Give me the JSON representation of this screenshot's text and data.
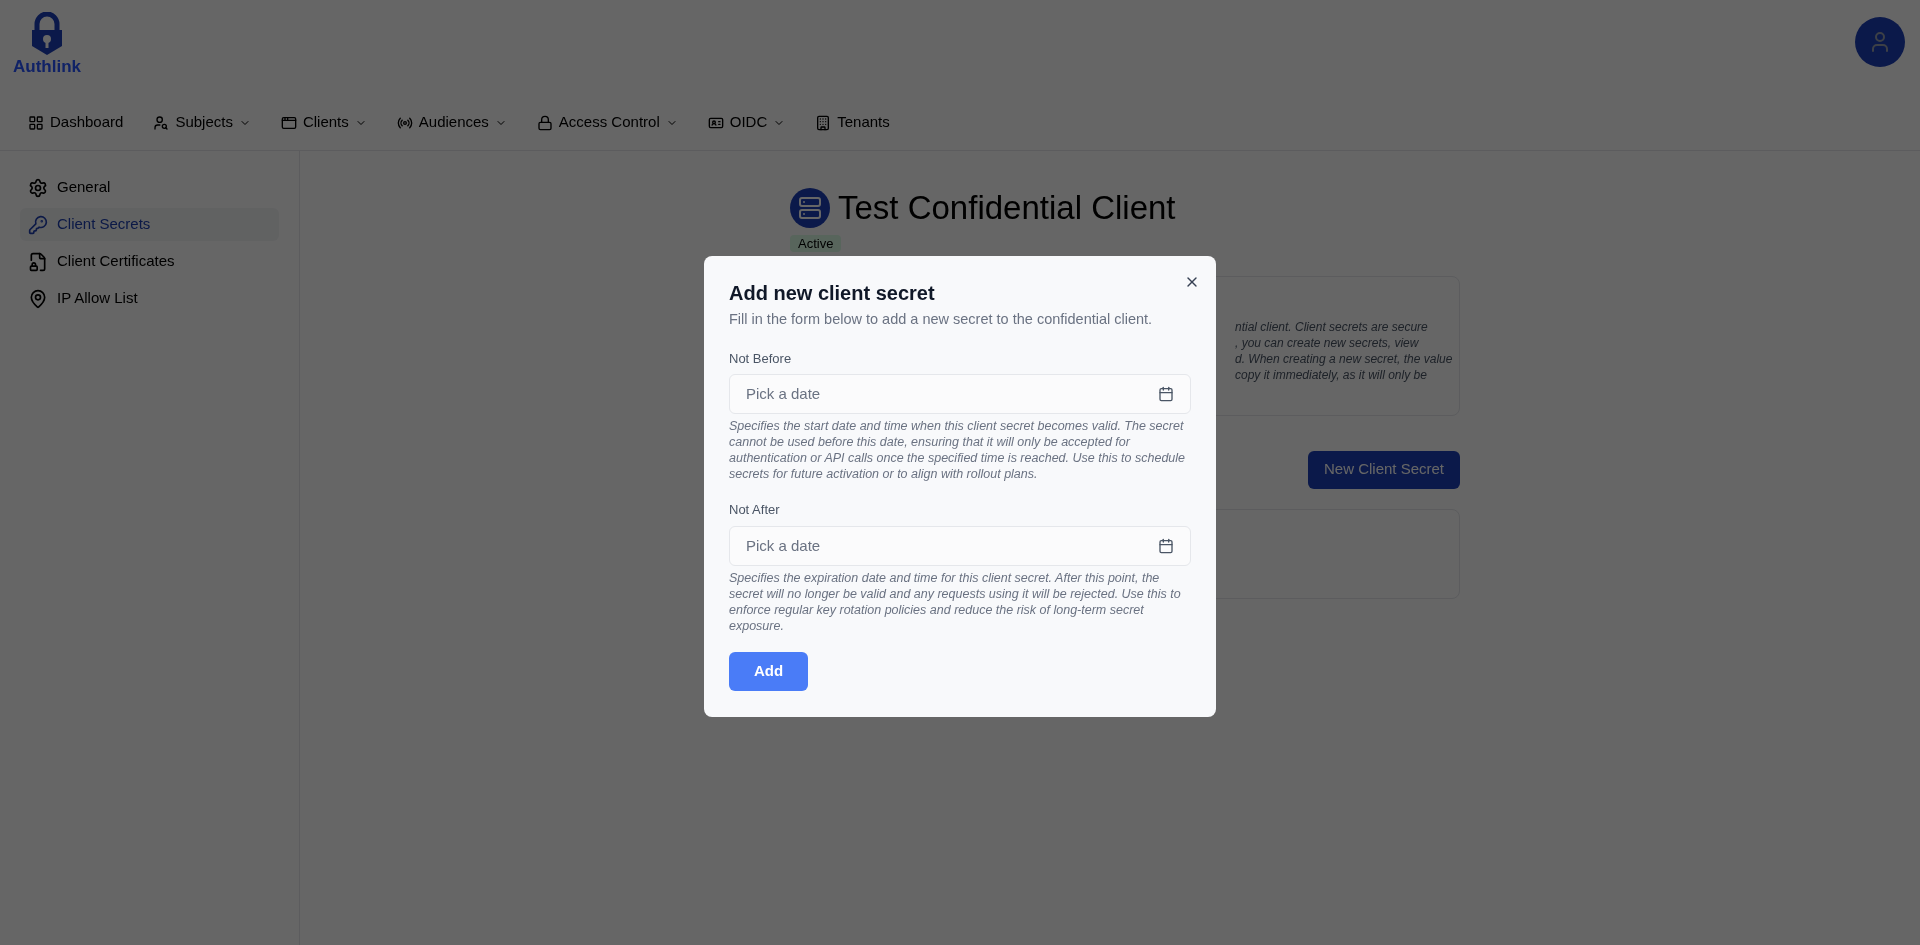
{
  "logo": {
    "text": "Authlink"
  },
  "nav": [
    {
      "label": "Dashboard",
      "has_menu": false
    },
    {
      "label": "Subjects",
      "has_menu": true
    },
    {
      "label": "Clients",
      "has_menu": true
    },
    {
      "label": "Audiences",
      "has_menu": true
    },
    {
      "label": "Access Control",
      "has_menu": true
    },
    {
      "label": "OIDC",
      "has_menu": true
    },
    {
      "label": "Tenants",
      "has_menu": false
    }
  ],
  "sidebar": {
    "items": [
      {
        "label": "General",
        "selected": false
      },
      {
        "label": "Client Secrets",
        "selected": true
      },
      {
        "label": "Client Certificates",
        "selected": false
      },
      {
        "label": "IP Allow List",
        "selected": false
      }
    ]
  },
  "client": {
    "title": "Test Confidential Client",
    "status": "Active"
  },
  "info_card": {
    "lines": [
      "ntial client. Client secrets are secure",
      ", you can create new secrets, view",
      "d. When creating a new secret, the value",
      "copy it immediately, as it will only be"
    ]
  },
  "new_secret_button": "New Client Secret",
  "dialog": {
    "title": "Add new client secret",
    "description": "Fill in the form below to add a new secret to the confidential client.",
    "fields": [
      {
        "label": "Not Before",
        "placeholder": "Pick a date",
        "help": "Specifies the start date and time when this client secret becomes valid. The secret cannot be used before this date, ensuring that it will only be accepted for authentication or API calls once the specified time is reached. Use this to schedule secrets for future activation or to align with rollout plans."
      },
      {
        "label": "Not After",
        "placeholder": "Pick a date",
        "help": "Specifies the expiration date and time for this client secret. After this point, the secret will no longer be valid and any requests using it will be rejected. Use this to enforce regular key rotation policies and reduce the risk of long-term secret exposure."
      }
    ],
    "submit": "Add"
  }
}
